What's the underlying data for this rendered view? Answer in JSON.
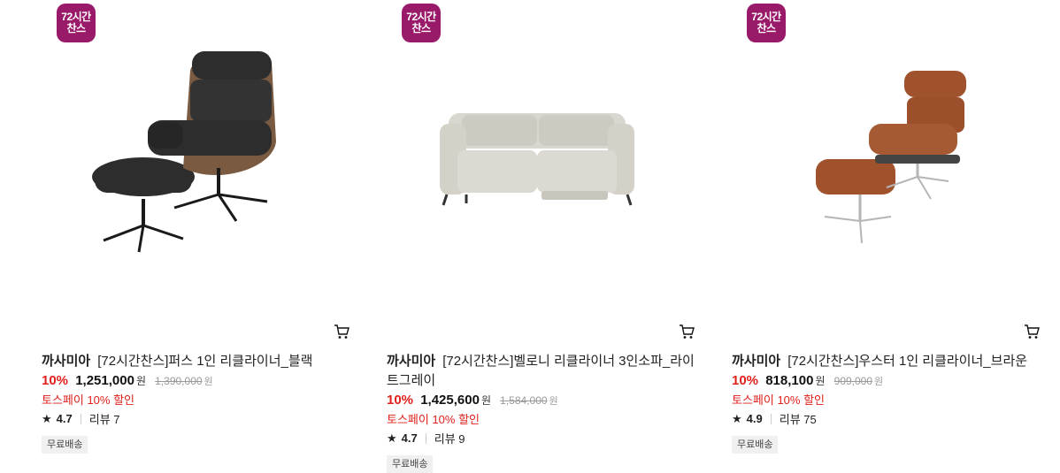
{
  "products": [
    {
      "badge_line1": "72시간",
      "badge_line2": "찬스",
      "brand": "까사미아",
      "name": "[72시간찬스]퍼스 1인 리클라이너_블랙",
      "discount": "10%",
      "price": "1,251,000",
      "currency": "원",
      "original_price": "1,390,000",
      "original_currency": "원",
      "promo": "토스페이 10% 할인",
      "rating": "4.7",
      "review_label": "리뷰 7",
      "shipping": "무료배송",
      "color": "#2d2d2d",
      "icon": "cart-icon"
    },
    {
      "badge_line1": "72시간",
      "badge_line2": "찬스",
      "brand": "까사미아",
      "name": "[72시간찬스]벨로니 리클라이너 3인소파_라이트그레이",
      "discount": "10%",
      "price": "1,425,600",
      "currency": "원",
      "original_price": "1,584,000",
      "original_currency": "원",
      "promo": "토스페이 10% 할인",
      "rating": "4.7",
      "review_label": "리뷰 9",
      "shipping": "무료배송",
      "color": "#d8d5cd",
      "icon": "cart-icon"
    },
    {
      "badge_line1": "72시간",
      "badge_line2": "찬스",
      "brand": "까사미아",
      "name": "[72시간찬스]우스터 1인 리클라이너_브라운",
      "discount": "10%",
      "price": "818,100",
      "currency": "원",
      "original_price": "909,000",
      "original_currency": "원",
      "promo": "토스페이 10% 할인",
      "rating": "4.9",
      "review_label": "리뷰 75",
      "shipping": "무료배송",
      "color": "#a0522d",
      "icon": "cart-icon"
    }
  ],
  "colors": {
    "badge": "#9a1a6a",
    "discount": "#e0201b",
    "promo": "#e0201b"
  }
}
